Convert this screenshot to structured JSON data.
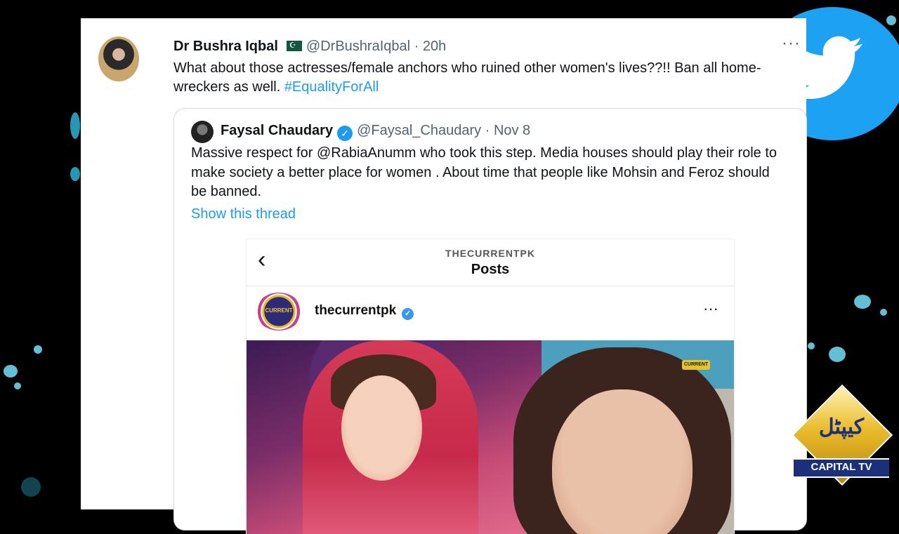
{
  "tweet": {
    "author_name": "Dr Bushra Iqbal",
    "handle": "@DrBushraIqbal",
    "separator": "·",
    "time": "20h",
    "more_label": "···",
    "text": "What about those actresses/female anchors who ruined other women's lives??!! Ban all home-wreckers as well. ",
    "hashtag": "#EqualityForAll"
  },
  "quote": {
    "author_name": "Faysal Chaudary",
    "verified_glyph": "✓",
    "handle": "@Faysal_Chaudary",
    "separator": "·",
    "date": "Nov 8",
    "text": "Massive respect for @RabiaAnumm who took this step.  Media houses should play their role to make society a better place for women . About time that people like Mohsin and Feroz should be banned.",
    "show_thread": "Show this thread"
  },
  "instagram": {
    "back_glyph": "‹",
    "account_title": "THECURRENTPK",
    "page_title": "Posts",
    "avatar_text": "CURRENT",
    "username": "thecurrentpk",
    "verified_glyph": "✓",
    "more_label": "···",
    "watermark_text": "CURRENT"
  },
  "logo": {
    "urdu_text": "کیپٹل",
    "text": "CAPITAL TV"
  },
  "colors": {
    "link": "#1d9bf0",
    "twitter_blue": "#1da1f2",
    "logo_gold": "#e9bb2b",
    "logo_navy": "#1b2f7a"
  }
}
